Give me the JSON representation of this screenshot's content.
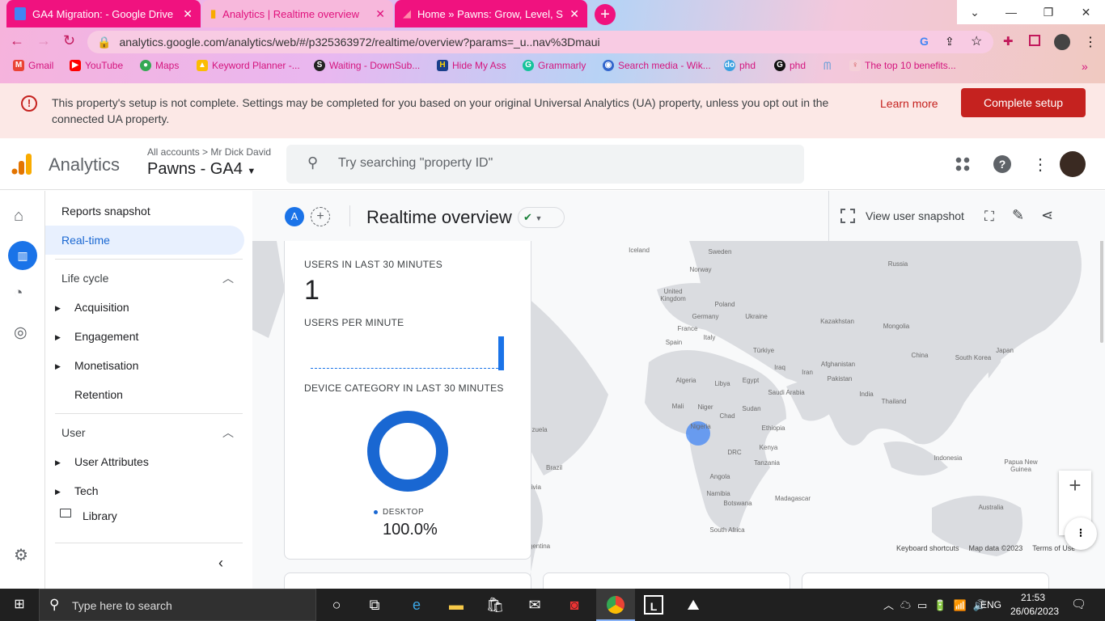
{
  "browser": {
    "tabs": [
      {
        "title": "GA4 Migration: - Google Drive",
        "icon": "google-docs-icon"
      },
      {
        "title": "Analytics | Realtime overview",
        "icon": "analytics-icon"
      },
      {
        "title": "Home » Pawns: Grow, Level, Step",
        "icon": "site-icon"
      }
    ],
    "url": "analytics.google.com/analytics/web/#/p325363972/realtime/overview?params=_u..nav%3Dmaui",
    "bookmarks": [
      "Gmail",
      "YouTube",
      "Maps",
      "Keyword Planner -...",
      "Waiting - DownSub...",
      "Hide My Ass",
      "Grammarly",
      "Search media - Wik...",
      "phd",
      "phd",
      "The top 10 benefits..."
    ],
    "bookmarks_overflow": "»"
  },
  "banner": {
    "text": "This property's setup is not complete. Settings may be completed for you based on your original Universal Analytics (UA) property, unless you opt out in the connected UA property.",
    "learn_more": "Learn more",
    "complete_setup": "Complete setup",
    "accent": "#c5221f"
  },
  "header": {
    "app_name": "Analytics",
    "breadcrumb": "All accounts > Mr Dick David",
    "property": "Pawns - GA4",
    "search_placeholder": "Try searching \"property ID\""
  },
  "sidebar": {
    "reports_snapshot": "Reports snapshot",
    "realtime": "Real-time",
    "lifecycle": "Life cycle",
    "lifecycle_items": [
      "Acquisition",
      "Engagement",
      "Monetisation",
      "Retention"
    ],
    "user": "User",
    "user_items": [
      "User Attributes",
      "Tech"
    ],
    "library": "Library"
  },
  "toolbar": {
    "avatar_letter": "A",
    "title": "Realtime overview",
    "view_snapshot": "View user snapshot"
  },
  "card": {
    "users_30_label": "USERS IN LAST 30 MINUTES",
    "users_30_value": "1",
    "users_per_minute_label": "USERS PER MINUTE",
    "device_label": "DEVICE CATEGORY IN LAST 30 MINUTES",
    "device_name": "DESKTOP",
    "device_pct": "100.0%",
    "device_color": "#1967d2"
  },
  "map": {
    "labels": [
      "Iceland",
      "Sweden",
      "Norway",
      "United Kingdom",
      "Poland",
      "Germany",
      "Ukraine",
      "France",
      "Italy",
      "Spain",
      "Russia",
      "Kazakhstan",
      "Mongolia",
      "Türkiye",
      "China",
      "South Korea",
      "Japan",
      "Iraq",
      "Iran",
      "Afghanistan",
      "Pakistan",
      "Algeria",
      "Libya",
      "Egypt",
      "Saudi Arabia",
      "India",
      "Thailand",
      "Mali",
      "Niger",
      "Sudan",
      "Chad",
      "Nigeria",
      "Ethiopia",
      "Kenya",
      "DRC",
      "Tanzania",
      "Indonesia",
      "Papua New Guinea",
      "Brazil",
      "Angola",
      "Namibia",
      "Botswana",
      "Madagascar",
      "Australia",
      "South Africa",
      "zuela",
      "livia",
      "gentina"
    ],
    "footer": [
      "Keyboard shortcuts",
      "Map data ©2023",
      "Terms of Use"
    ],
    "zoom_in": "+",
    "highlight_country": "Nigeria"
  },
  "taskbar": {
    "search_placeholder": "Type here to search",
    "time": "21:53",
    "date": "26/06/2023",
    "lang": "ENG"
  }
}
